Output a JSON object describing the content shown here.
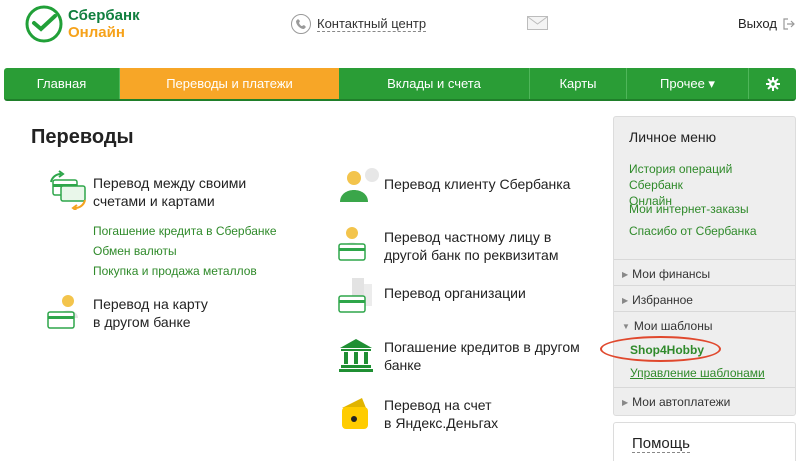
{
  "header": {
    "logo_line1": "Сбербанк",
    "logo_line2": "Онлайн",
    "contact_center": "Контактный центр",
    "logout": "Выход"
  },
  "nav": {
    "items": [
      {
        "label": "Главная"
      },
      {
        "label": "Переводы и платежи"
      },
      {
        "label": "Вклады и счета"
      },
      {
        "label": "Карты"
      },
      {
        "label": "Прочее ▾"
      }
    ],
    "settings_icon": "gear-icon"
  },
  "main": {
    "title": "Переводы",
    "left_items": [
      {
        "label": "Перевод между своими\nсчетами и картами",
        "icon": "cards-transfer-icon"
      },
      {
        "label": "Перевод на карту\nв другом банке",
        "icon": "person-card-icon"
      }
    ],
    "sublinks": [
      "Погашение кредита в Сбербанке",
      "Обмен валюты",
      "Покупка и продажа металлов"
    ],
    "right_items": [
      {
        "label": "Перевод клиенту Сбербанка",
        "icon": "person-client-icon"
      },
      {
        "label": "Перевод частному лицу в\nдругой банк по реквизитам",
        "icon": "person-card-icon"
      },
      {
        "label": "Перевод организации",
        "icon": "building-card-icon"
      },
      {
        "label": "Погашение кредитов в другом\nбанке",
        "icon": "bank-icon"
      },
      {
        "label": "Перевод на счет\nв Яндекс.Деньгах",
        "icon": "wallet-icon"
      }
    ]
  },
  "panel": {
    "title": "Личное меню",
    "links": [
      "История операций Сбербанк\nОнлайн",
      "Мои интернет-заказы",
      "Спасибо от Сбербанка"
    ],
    "sections": [
      {
        "label": "Мои финансы"
      },
      {
        "label": "Избранное"
      },
      {
        "label": "Мои шаблоны"
      },
      {
        "label": "Мои автоплатежи"
      }
    ],
    "templates": [
      "Shop4Hobby",
      "Управление шаблонами"
    ]
  },
  "help": {
    "title": "Помощь"
  },
  "colors": {
    "brand_green": "#2a9d36",
    "accent_orange": "#f7a627",
    "link_green": "#2f8a2a",
    "highlight_red": "#e0482d"
  }
}
